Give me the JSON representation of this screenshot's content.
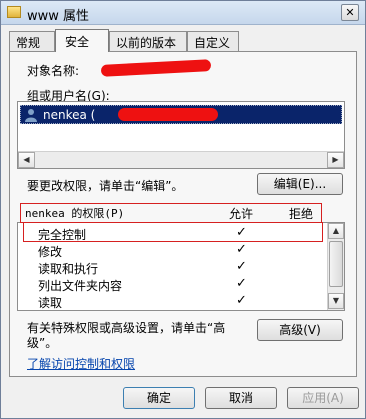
{
  "window": {
    "title_prefix": "www",
    "title_suffix": "属性",
    "close_symbol": "✕"
  },
  "tabs": [
    {
      "label": "常规"
    },
    {
      "label": "安全"
    },
    {
      "label": "以前的版本"
    },
    {
      "label": "自定义"
    }
  ],
  "security": {
    "object_name_label": "对象名称:",
    "groups_label": "组或用户名(G):",
    "group_item": "nenkea (",
    "change_perm_text": "要更改权限，请单击“编辑”。",
    "edit_button": "编辑(E)...",
    "perm_header_title": "nenkea 的权限(P)",
    "allow_header": "允许",
    "deny_header": "拒绝",
    "permissions": [
      {
        "name": "完全控制",
        "allow": "✓"
      },
      {
        "name": "修改",
        "allow": "✓"
      },
      {
        "name": "读取和执行",
        "allow": "✓"
      },
      {
        "name": "列出文件夹内容",
        "allow": "✓"
      },
      {
        "name": "读取",
        "allow": "✓"
      }
    ],
    "advanced_text_line1": "有关特殊权限或高级设置，请单击“高",
    "advanced_text_line2": "级”。",
    "advanced_button": "高级(V)",
    "learn_link": "了解访问控制和权限"
  },
  "footer": {
    "ok": "确定",
    "cancel": "取消",
    "apply": "应用(A)"
  },
  "colors": {
    "selection": "#0a246a",
    "redaction": "#ee1111",
    "highlight_border": "#d62020",
    "link": "#0645ad"
  }
}
